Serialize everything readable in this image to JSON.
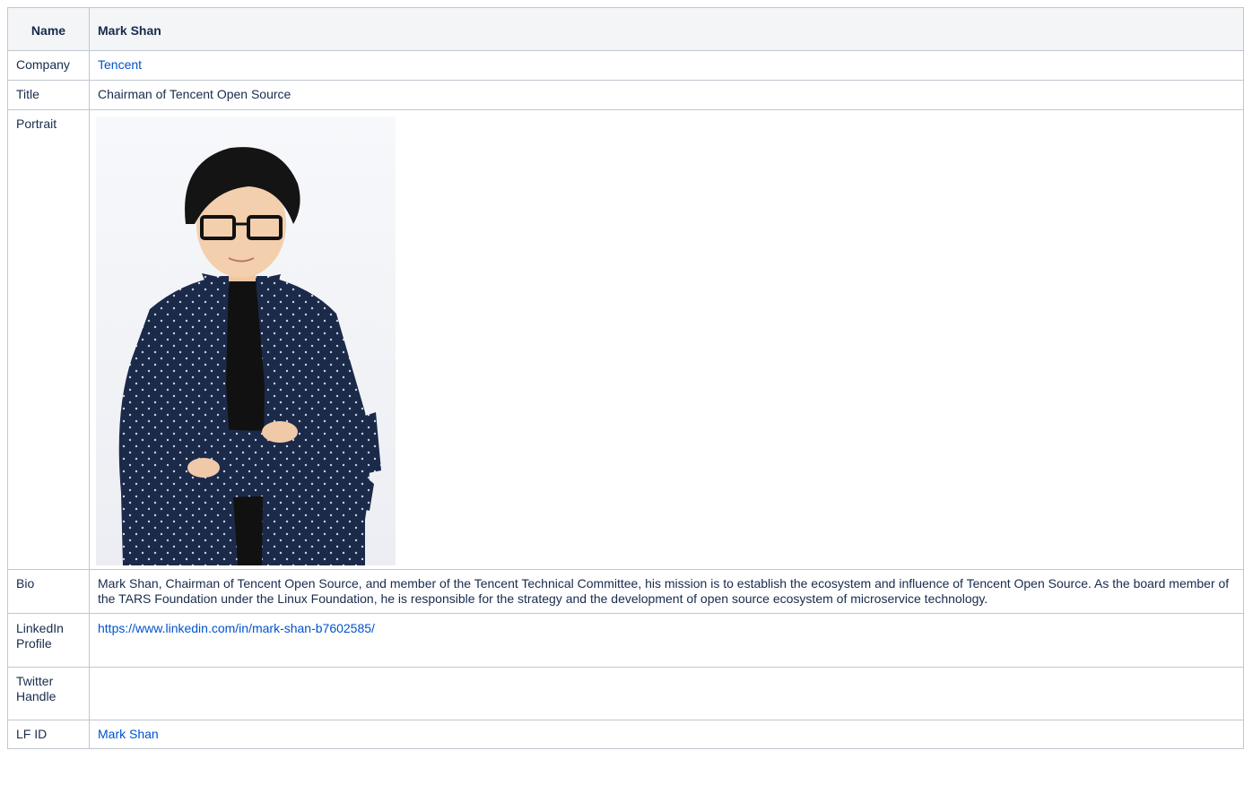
{
  "table": {
    "header": {
      "label": "Name",
      "value": "Mark Shan"
    },
    "rows": {
      "company": {
        "label": "Company",
        "value": "Tencent"
      },
      "title": {
        "label": "Title",
        "value": "Chairman of Tencent Open Source"
      },
      "portrait": {
        "label": "Portrait"
      },
      "bio": {
        "label": "Bio",
        "value": "Mark Shan, Chairman of Tencent Open Source, and member of the Tencent Technical Committee, his mission is to establish the ecosystem and influence of Tencent Open Source. As the board member of the TARS Foundation under the Linux Foundation, he is responsible for the strategy and the development of open source ecosystem of microservice technology."
      },
      "linkedin": {
        "label": "LinkedIn Profile",
        "value": "https://www.linkedin.com/in/mark-shan-b7602585/"
      },
      "twitter": {
        "label": "Twitter Handle",
        "value": ""
      },
      "lfid": {
        "label": "LF ID",
        "value": "Mark Shan"
      }
    }
  },
  "colors": {
    "link": "#0052cc",
    "border": "#c1c7d0",
    "header_bg": "#f4f5f7",
    "text": "#172b4d"
  }
}
